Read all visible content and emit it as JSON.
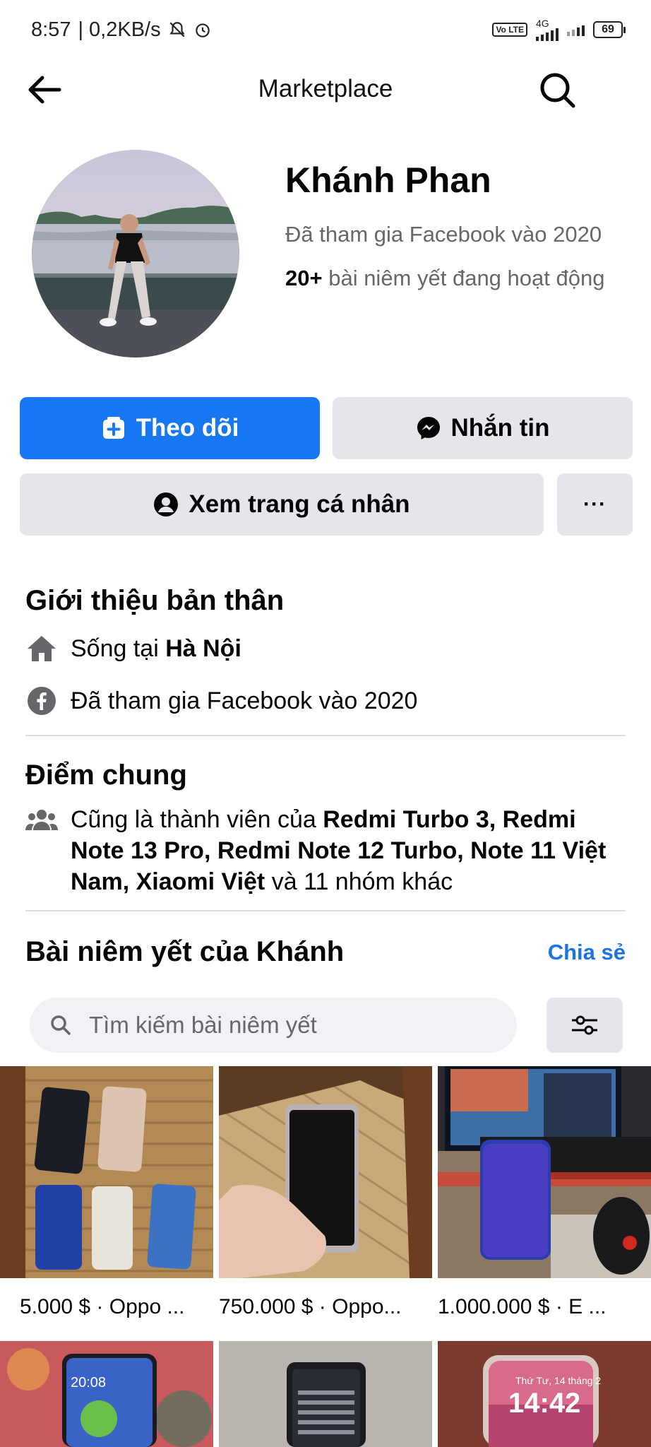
{
  "status_bar": {
    "time": "8:57",
    "speed": "| 0,2KB/s",
    "network": "4G",
    "volte": "Vo LTE",
    "battery": "69"
  },
  "nav": {
    "title": "Marketplace",
    "back_icon": "arrow-left-icon",
    "search_icon": "search-icon"
  },
  "profile": {
    "name": "Khánh Phan",
    "joined": "Đã tham gia Facebook vào 2020",
    "listings_count": "20+",
    "listings_text": " bài niêm yết đang hoạt động"
  },
  "actions": {
    "follow_label": "Theo dõi",
    "message_label": "Nhắn tin",
    "view_profile_label": "Xem trang cá nhân",
    "more_label": "···"
  },
  "about": {
    "title": "Giới thiệu bản thân",
    "lives_prefix": "Sống tại ",
    "lives_city": "Hà Nội",
    "joined": "Đã tham gia Facebook vào 2020"
  },
  "common": {
    "title": "Điểm chung",
    "groups_prefix": "Cũng là thành viên của ",
    "groups_bold": "Redmi Turbo 3, Redmi Note 13 Pro, Redmi Note 12 Turbo,  Note 11 Việt Nam, Xiaomi Việt",
    "groups_suffix": " và 11 nhóm khác"
  },
  "listings": {
    "title": "Bài niêm yết của Khánh",
    "share_label": "Chia sẻ",
    "search_placeholder": "Tìm kiếm bài niêm yết",
    "items": [
      {
        "caption": "5.000 $ · Oppo ..."
      },
      {
        "caption": "750.000 $ · Oppo..."
      },
      {
        "caption": "1.000.000 $ · E ..."
      }
    ],
    "row2_items": [
      {
        "time_text": "20:08"
      },
      {
        "time_text": ""
      },
      {
        "time_text": "14:42",
        "date_text": "Thứ Tư, 14 tháng 2"
      }
    ]
  },
  "colors": {
    "brand_blue": "#1877f2",
    "link_blue": "#1b74e4",
    "button_gray": "#e4e6eb",
    "secondary_text": "#65676b"
  }
}
